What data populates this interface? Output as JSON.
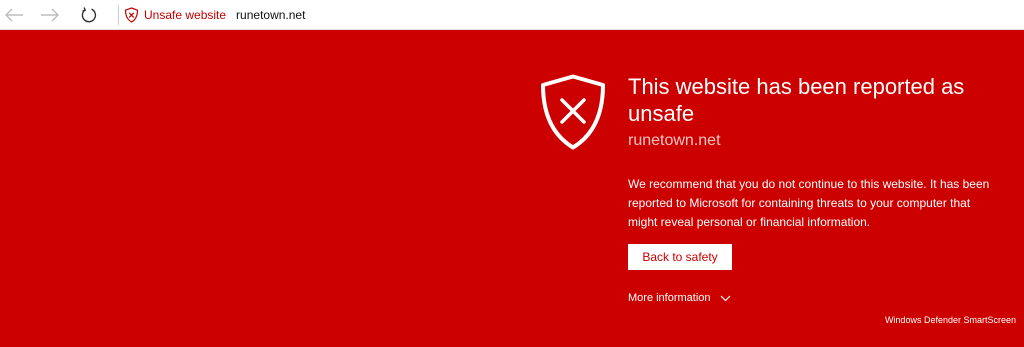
{
  "toolbar": {
    "back_icon": "arrow-left-icon",
    "forward_icon": "arrow-right-icon",
    "refresh_icon": "refresh-icon",
    "badge_icon": "shield-x-icon",
    "unsafe_label": "Unsafe website",
    "url": "runetown.net"
  },
  "warning": {
    "shield_icon": "shield-x-icon",
    "heading": "This website has been reported as unsafe",
    "site": "runetown.net",
    "description": "We recommend that you do not continue to this website. It has been reported to Microsoft for containing threats to your computer that might reveal personal or financial information.",
    "back_button": "Back to safety",
    "more_info": "More information",
    "more_info_icon": "chevron-down-icon",
    "footer": "Windows Defender SmartScreen"
  },
  "colors": {
    "warning_background": "#cd0000",
    "accent_red": "#c50000",
    "text_white": "#ffffff",
    "site_name": "#f1c2c2"
  }
}
